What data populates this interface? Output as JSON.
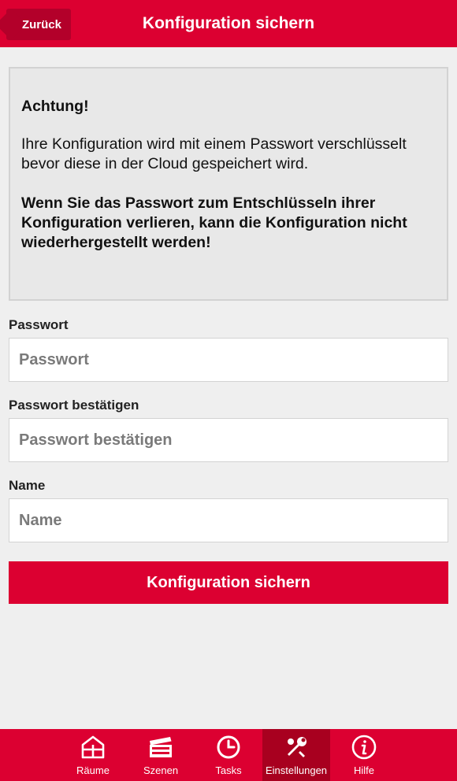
{
  "header": {
    "back_label": "Zurück",
    "title": "Konfiguration sichern"
  },
  "warning": {
    "title": "Achtung!",
    "body": "Ihre Konfiguration wird mit einem Passwort verschlüsselt bevor diese in der Cloud gespeichert wird.",
    "emphasis": "Wenn Sie das Passwort zum Entschlüsseln ihrer Konfiguration verlieren, kann die Konfiguration nicht wiederhergestellt werden!"
  },
  "form": {
    "password": {
      "label": "Passwort",
      "placeholder": "Passwort",
      "value": ""
    },
    "password_confirm": {
      "label": "Passwort bestätigen",
      "placeholder": "Passwort bestätigen",
      "value": ""
    },
    "name": {
      "label": "Name",
      "placeholder": "Name",
      "value": ""
    },
    "submit_label": "Konfiguration sichern"
  },
  "tabbar": {
    "items": [
      {
        "label": "Räume",
        "icon": "rooms-icon"
      },
      {
        "label": "Szenen",
        "icon": "clapperboard-icon"
      },
      {
        "label": "Tasks",
        "icon": "clock-icon"
      },
      {
        "label": "Einstellungen",
        "icon": "tools-icon",
        "active": true
      },
      {
        "label": "Hilfe",
        "icon": "info-icon"
      }
    ]
  },
  "colors": {
    "brand": "#dc0031",
    "brand_dark": "#a8001f",
    "background": "#efefef"
  }
}
